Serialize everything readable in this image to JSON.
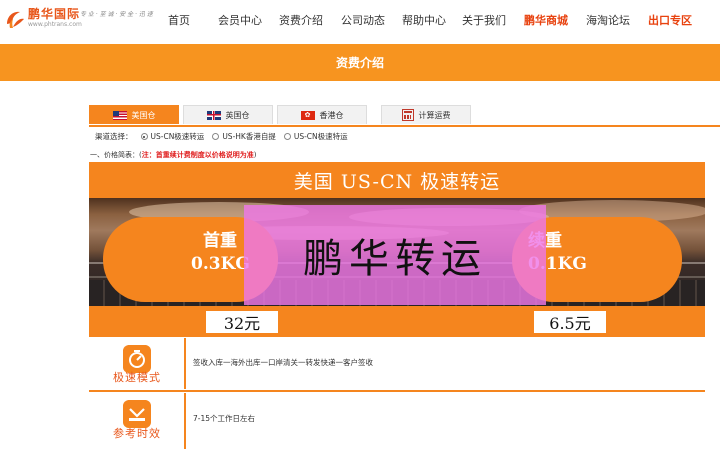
{
  "logo": {
    "name": "鹏华国际",
    "sub": "www.phtrans.com",
    "slogan": "专 业 · 至 诚 · 安 全 · 迅 速"
  },
  "nav": [
    {
      "label": "首页"
    },
    {
      "label": "会员中心"
    },
    {
      "label": "资费介绍"
    },
    {
      "label": "公司动态"
    },
    {
      "label": "帮助中心"
    },
    {
      "label": "关于我们"
    },
    {
      "label": "鹏华商城"
    },
    {
      "label": "海淘论坛"
    },
    {
      "label": "出口专区"
    }
  ],
  "banner": {
    "title": "资费介绍"
  },
  "tabs": [
    {
      "label": "美国仓",
      "icon": "us-flag-icon"
    },
    {
      "label": "英国仓",
      "icon": "uk-flag-icon"
    },
    {
      "label": "香港仓",
      "icon": "hk-flag-icon"
    },
    {
      "label": "计算运费",
      "icon": "calculator-icon"
    }
  ],
  "channel": {
    "label": "渠道选择：",
    "options": [
      "US-CN极速转运",
      "US-HK香港自提",
      "US-CN极速特运"
    ],
    "selected": 0
  },
  "pricing_note": {
    "prefix": "一、价格简表：(",
    "warning": "注：首重续计费制度以价格说明为准",
    "suffix": ")"
  },
  "promo": {
    "title": "美国 US-CN  极速转运",
    "first_weight_label": "首重",
    "first_weight_value": "0.3KG",
    "extra_weight_label": "续重",
    "extra_weight_value": "0.1KG",
    "first_price": "32元",
    "extra_price": "6.5元",
    "watermark": "鹏华转运"
  },
  "features": [
    {
      "label": "极速模式",
      "icon": "speed-icon",
      "text": "签收入库一海外出库一口岸清关一转发快递一客户签收"
    },
    {
      "label": "参考时效",
      "icon": "clock-icon",
      "text": "7-15个工作日左右"
    }
  ],
  "colors": {
    "accent": "#f5851e",
    "nav_highlight": "#e8420f",
    "warning": "#e02020",
    "watermark": "#ee78e6"
  }
}
